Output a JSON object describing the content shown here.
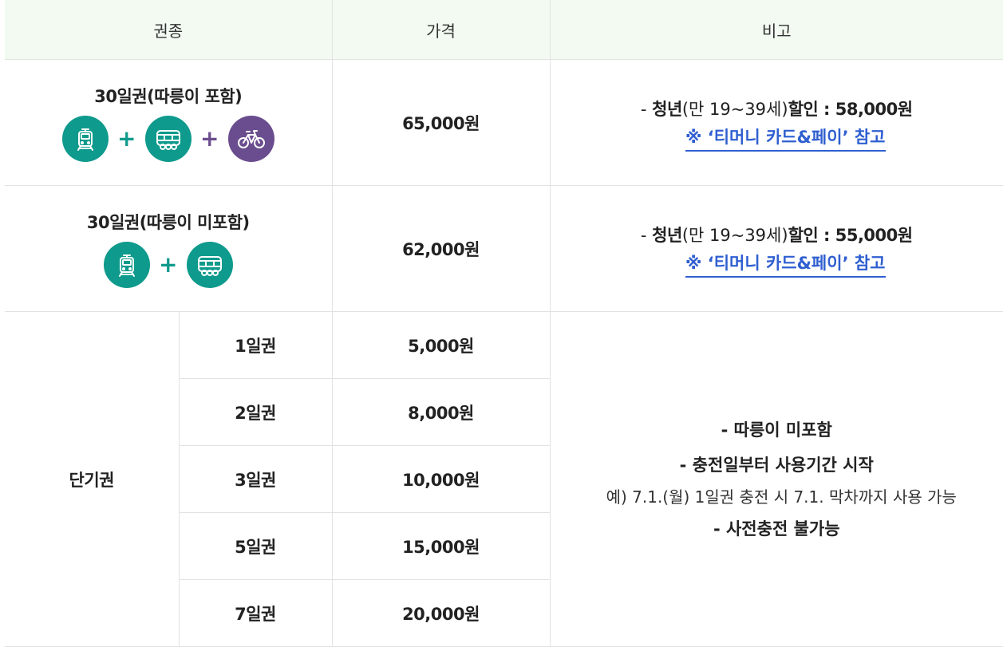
{
  "colors": {
    "header_bg": "#f2faf2",
    "teal": "#0e9a8c",
    "purple": "#6a4d8e",
    "link": "#2f5fd0",
    "border": "#e2e2e2"
  },
  "header": {
    "col_type": "권종",
    "col_price": "가격",
    "col_note": "비고"
  },
  "passes": [
    {
      "title": "30일권(따릉이 포함)",
      "price": "65,000원",
      "icons": [
        "subway-icon",
        "bus-icon",
        "bicycle-icon"
      ],
      "plus": "+",
      "note": {
        "dash": "- ",
        "lead": "청년",
        "paren": "(만 19~39세)",
        "rest": "할인 : 58,000원",
        "link": "※ ‘티머니 카드&페이’ 참고"
      }
    },
    {
      "title": "30일권(따릉이 미포함)",
      "price": "62,000원",
      "icons": [
        "subway-icon",
        "bus-icon"
      ],
      "plus": "+",
      "note": {
        "dash": "- ",
        "lead": "청년",
        "paren": "(만 19~39세)",
        "rest": "할인 : 55,000원",
        "link": "※ ‘티머니 카드&페이’ 참고"
      }
    }
  ],
  "short_term": {
    "label": "단기권",
    "rows": [
      {
        "name": "1일권",
        "price": "5,000원"
      },
      {
        "name": "2일권",
        "price": "8,000원"
      },
      {
        "name": "3일권",
        "price": "10,000원"
      },
      {
        "name": "5일권",
        "price": "15,000원"
      },
      {
        "name": "7일권",
        "price": "20,000원"
      }
    ],
    "notes": {
      "line1": "- 따릉이 미포함",
      "line2": "- 충전일부터 사용기간 시작",
      "example": "예) 7.1.(월) 1일권 충전 시 7.1. 막차까지 사용 가능",
      "line3": "- 사전충전 불가능"
    }
  }
}
